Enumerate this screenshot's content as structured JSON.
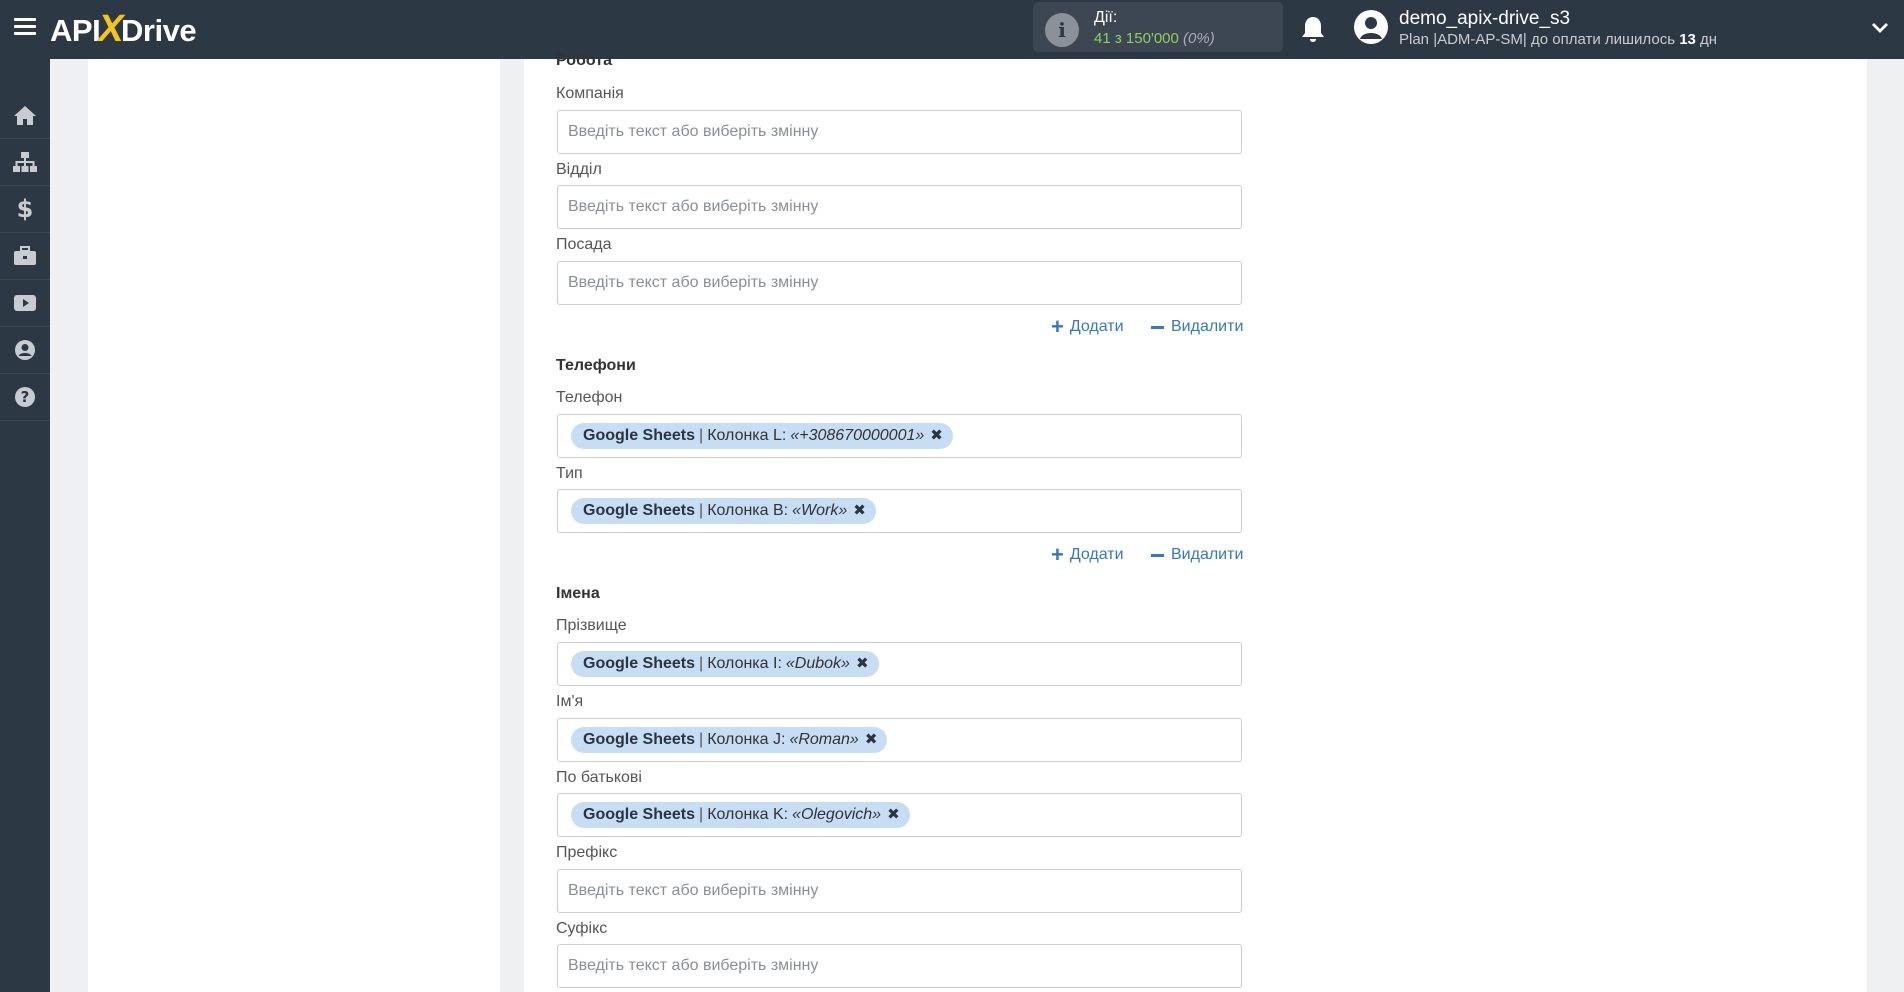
{
  "header": {
    "brand_api": "API",
    "brand_x": "X",
    "brand_drive": "Drive",
    "actions_label": "Дії:",
    "actions_used": "41",
    "actions_of": "з",
    "actions_total": "150'000",
    "actions_pct": "(0%)",
    "username": "demo_apix-drive_s3",
    "plan_text": "Plan |ADM-AP-SM| до оплати лишилось",
    "days_left": "13",
    "days_unit": "дн"
  },
  "sidebar": {
    "items": [
      "home-icon",
      "sitemap-icon",
      "dollar-icon",
      "briefcase-icon",
      "video-icon",
      "user-icon",
      "help-icon"
    ]
  },
  "form": {
    "placeholder": "Введіть текст або виберіть змінну",
    "add_label": "Додати",
    "remove_label": "Видалити",
    "sections": {
      "work": {
        "title": "Робота",
        "company_label": "Компанія",
        "department_label": "Відділ",
        "position_label": "Посада"
      },
      "phones": {
        "title": "Телефони",
        "phone_label": "Телефон",
        "phone_chip": {
          "source": "Google Sheets",
          "column": "Колонка L:",
          "value": "«+308670000001»"
        },
        "type_label": "Тип",
        "type_chip": {
          "source": "Google Sheets",
          "column": "Колонка B:",
          "value": "«Work»"
        }
      },
      "names": {
        "title": "Імена",
        "last_name_label": "Прізвище",
        "last_name_chip": {
          "source": "Google Sheets",
          "column": "Колонка I:",
          "value": "«Dubok»"
        },
        "first_name_label": "Ім'я",
        "first_name_chip": {
          "source": "Google Sheets",
          "column": "Колонка J:",
          "value": "«Roman»"
        },
        "patronymic_label": "По батькові",
        "patronymic_chip": {
          "source": "Google Sheets",
          "column": "Колонка K:",
          "value": "«Olegovich»"
        },
        "prefix_label": "Префікс",
        "suffix_label": "Суфікс"
      }
    }
  }
}
